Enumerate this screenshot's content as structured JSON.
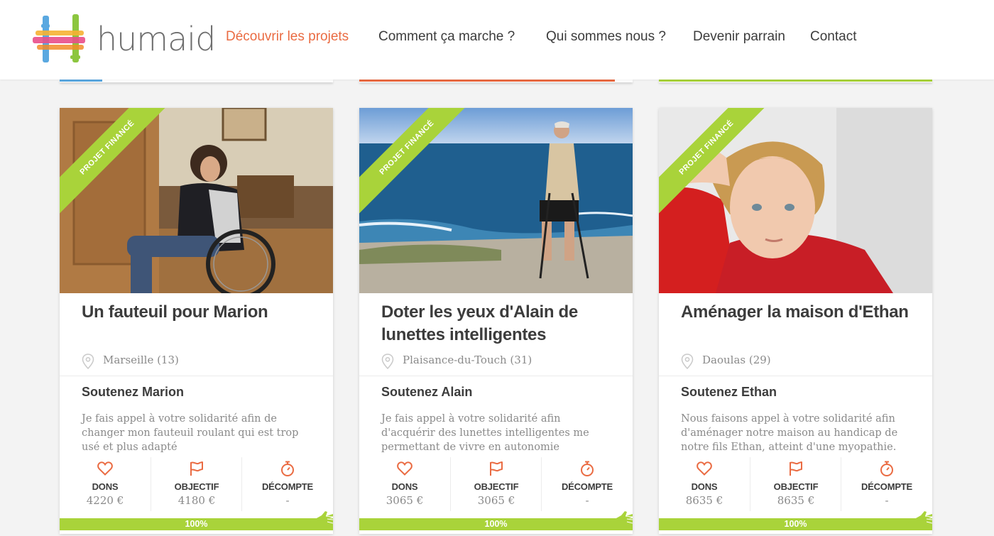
{
  "header": {
    "logo_text": "humaid",
    "nav": [
      {
        "label": "Découvrir les projets",
        "active": true
      },
      {
        "label": "Comment ça marche ?",
        "active": false
      },
      {
        "label": "Qui sommes nous ?",
        "active": false
      },
      {
        "label": "Devenir parrain",
        "active": false
      },
      {
        "label": "Contact",
        "active": false
      }
    ]
  },
  "colors": {
    "accent": "#ea6b42",
    "funded_green": "#a9d33a",
    "text_dark": "#3c3c3c",
    "text_muted": "#8a8a8a"
  },
  "cards": [
    {
      "ribbon": "PROJET FINANCÉ",
      "title": "Un fauteuil pour Marion",
      "location": "Marseille (13)",
      "support": "Soutenez Marion",
      "description": "Je fais appel à votre solidarité afin de changer mon fauteuil roulant qui est trop usé et plus adapté",
      "stats": [
        {
          "icon": "heart-icon",
          "label": "DONS",
          "value": "4220 €"
        },
        {
          "icon": "flag-icon",
          "label": "OBJECTIF",
          "value": "4180 €"
        },
        {
          "icon": "stopwatch-icon",
          "label": "DÉCOMPTE",
          "value": "-"
        }
      ],
      "progress_percent": 100,
      "progress_label": "100%"
    },
    {
      "ribbon": "PROJET FINANCÉ",
      "title": "Doter les yeux d'Alain de lunettes intelligentes",
      "location": "Plaisance-du-Touch (31)",
      "support": "Soutenez Alain",
      "description": "Je fais appel à votre solidarité afin d'acquérir des lunettes intelligentes me permettant de vivre en autonomie",
      "stats": [
        {
          "icon": "heart-icon",
          "label": "DONS",
          "value": "3065 €"
        },
        {
          "icon": "flag-icon",
          "label": "OBJECTIF",
          "value": "3065 €"
        },
        {
          "icon": "stopwatch-icon",
          "label": "DÉCOMPTE",
          "value": "-"
        }
      ],
      "progress_percent": 100,
      "progress_label": "100%"
    },
    {
      "ribbon": "PROJET FINANCÉ",
      "title": "Aménager la maison d'Ethan",
      "location": "Daoulas (29)",
      "support": "Soutenez Ethan",
      "description": "Nous faisons appel à votre solidarité afin d'aménager notre maison au handicap de notre fils Ethan, atteint d'une myopathie.",
      "stats": [
        {
          "icon": "heart-icon",
          "label": "DONS",
          "value": "8635 €"
        },
        {
          "icon": "flag-icon",
          "label": "OBJECTIF",
          "value": "8635 €"
        },
        {
          "icon": "stopwatch-icon",
          "label": "DÉCOMPTE",
          "value": "-"
        }
      ],
      "progress_percent": 100,
      "progress_label": "100%"
    }
  ]
}
